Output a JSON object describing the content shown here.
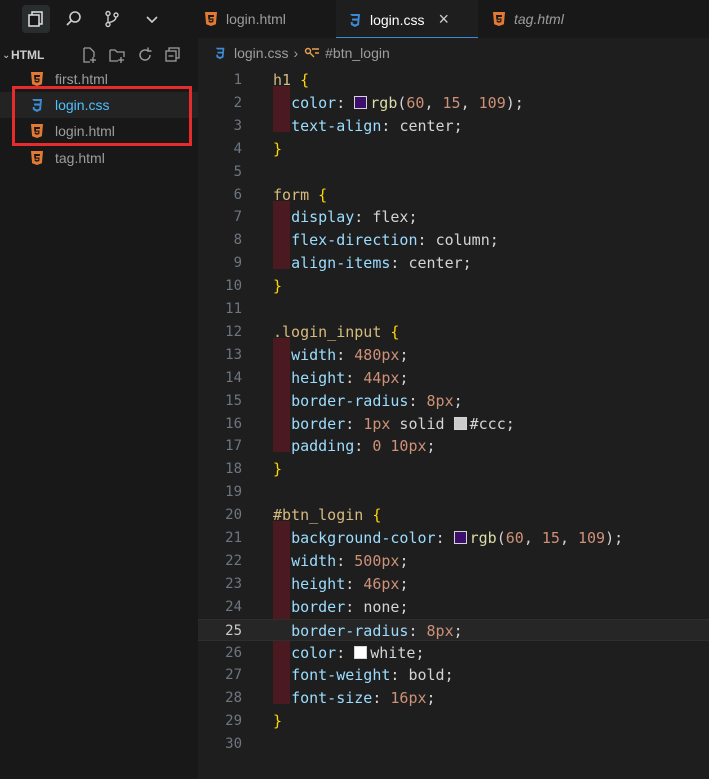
{
  "tabs": [
    {
      "label": "login.html",
      "active": false,
      "italic": false
    },
    {
      "label": "login.css",
      "active": true,
      "italic": false,
      "close": "×"
    },
    {
      "label": "tag.html",
      "active": false,
      "italic": true
    }
  ],
  "sidebar": {
    "title": "HTML",
    "files": [
      {
        "name": "first.html",
        "type": "html"
      },
      {
        "name": "login.css",
        "type": "css",
        "selected": true
      },
      {
        "name": "login.html",
        "type": "html"
      },
      {
        "name": "tag.html",
        "type": "html"
      }
    ]
  },
  "breadcrumb": {
    "file": "login.css",
    "symbol": "#btn_login"
  },
  "colors": {
    "html_icon": "#e37933",
    "css_icon": "#3c8bd7",
    "swatch_purple": "#3c0f6d",
    "swatch_ccc": "#cccccc",
    "swatch_white": "#ffffff",
    "annotation_box": "#e52b2b"
  },
  "code_lines": [
    {
      "n": "1",
      "tokens": [
        [
          "sel",
          "h1 "
        ],
        [
          "br",
          "{"
        ]
      ]
    },
    {
      "n": "2",
      "tokens": [
        [
          "ws",
          "  "
        ],
        [
          "prop",
          "color"
        ],
        [
          "plain",
          ": "
        ],
        [
          "swatch",
          "#3c0f6d"
        ],
        [
          "fn",
          "rgb"
        ],
        [
          "plain",
          "("
        ],
        [
          "num",
          "60"
        ],
        [
          "plain",
          ", "
        ],
        [
          "num",
          "15"
        ],
        [
          "plain",
          ", "
        ],
        [
          "num",
          "109"
        ],
        [
          "plain",
          ");"
        ]
      ]
    },
    {
      "n": "3",
      "tokens": [
        [
          "ws",
          "  "
        ],
        [
          "prop",
          "text-align"
        ],
        [
          "plain",
          ": "
        ],
        [
          "plain",
          "center"
        ],
        [
          "plain",
          ";"
        ]
      ]
    },
    {
      "n": "4",
      "tokens": [
        [
          "br",
          "}"
        ]
      ]
    },
    {
      "n": "5",
      "tokens": []
    },
    {
      "n": "6",
      "tokens": [
        [
          "sel",
          "form "
        ],
        [
          "br",
          "{"
        ]
      ]
    },
    {
      "n": "7",
      "tokens": [
        [
          "ws",
          "  "
        ],
        [
          "prop",
          "display"
        ],
        [
          "plain",
          ": "
        ],
        [
          "plain",
          "flex"
        ],
        [
          "plain",
          ";"
        ]
      ]
    },
    {
      "n": "8",
      "tokens": [
        [
          "ws",
          "  "
        ],
        [
          "prop",
          "flex-direction"
        ],
        [
          "plain",
          ": "
        ],
        [
          "plain",
          "column"
        ],
        [
          "plain",
          ";"
        ]
      ]
    },
    {
      "n": "9",
      "tokens": [
        [
          "ws",
          "  "
        ],
        [
          "prop",
          "align-items"
        ],
        [
          "plain",
          ": "
        ],
        [
          "plain",
          "center"
        ],
        [
          "plain",
          ";"
        ]
      ]
    },
    {
      "n": "10",
      "tokens": [
        [
          "br",
          "}"
        ]
      ]
    },
    {
      "n": "11",
      "tokens": []
    },
    {
      "n": "12",
      "tokens": [
        [
          "sel",
          ".login_input "
        ],
        [
          "br",
          "{"
        ]
      ]
    },
    {
      "n": "13",
      "tokens": [
        [
          "ws",
          "  "
        ],
        [
          "prop",
          "width"
        ],
        [
          "plain",
          ": "
        ],
        [
          "num",
          "480px"
        ],
        [
          "plain",
          ";"
        ]
      ]
    },
    {
      "n": "14",
      "tokens": [
        [
          "ws",
          "  "
        ],
        [
          "prop",
          "height"
        ],
        [
          "plain",
          ": "
        ],
        [
          "num",
          "44px"
        ],
        [
          "plain",
          ";"
        ]
      ]
    },
    {
      "n": "15",
      "tokens": [
        [
          "ws",
          "  "
        ],
        [
          "prop",
          "border-radius"
        ],
        [
          "plain",
          ": "
        ],
        [
          "num",
          "8px"
        ],
        [
          "plain",
          ";"
        ]
      ]
    },
    {
      "n": "16",
      "tokens": [
        [
          "ws",
          "  "
        ],
        [
          "prop",
          "border"
        ],
        [
          "plain",
          ": "
        ],
        [
          "num",
          "1px"
        ],
        [
          "plain",
          " solid "
        ],
        [
          "swatch",
          "#cccccc"
        ],
        [
          "fn2",
          "#ccc"
        ],
        [
          "plain",
          ";"
        ]
      ]
    },
    {
      "n": "17",
      "tokens": [
        [
          "ws",
          "  "
        ],
        [
          "prop",
          "padding"
        ],
        [
          "plain",
          ": "
        ],
        [
          "num",
          "0"
        ],
        [
          "plain",
          " "
        ],
        [
          "num",
          "10px"
        ],
        [
          "plain",
          ";"
        ]
      ]
    },
    {
      "n": "18",
      "tokens": [
        [
          "br",
          "}"
        ]
      ]
    },
    {
      "n": "19",
      "tokens": []
    },
    {
      "n": "20",
      "tokens": [
        [
          "sel2",
          "#btn_login "
        ],
        [
          "br",
          "{"
        ]
      ]
    },
    {
      "n": "21",
      "tokens": [
        [
          "ws",
          "  "
        ],
        [
          "prop",
          "background-color"
        ],
        [
          "plain",
          ": "
        ],
        [
          "swatch",
          "#3c0f6d"
        ],
        [
          "fn",
          "rgb"
        ],
        [
          "plain",
          "("
        ],
        [
          "num",
          "60"
        ],
        [
          "plain",
          ", "
        ],
        [
          "num",
          "15"
        ],
        [
          "plain",
          ", "
        ],
        [
          "num",
          "109"
        ],
        [
          "plain",
          ");"
        ]
      ]
    },
    {
      "n": "22",
      "tokens": [
        [
          "ws",
          "  "
        ],
        [
          "prop",
          "width"
        ],
        [
          "plain",
          ": "
        ],
        [
          "num",
          "500px"
        ],
        [
          "plain",
          ";"
        ]
      ]
    },
    {
      "n": "23",
      "tokens": [
        [
          "ws",
          "  "
        ],
        [
          "prop",
          "height"
        ],
        [
          "plain",
          ": "
        ],
        [
          "num",
          "46px"
        ],
        [
          "plain",
          ";"
        ]
      ]
    },
    {
      "n": "24",
      "tokens": [
        [
          "ws",
          "  "
        ],
        [
          "prop",
          "border"
        ],
        [
          "plain",
          ": "
        ],
        [
          "plain",
          "none"
        ],
        [
          "plain",
          ";"
        ]
      ]
    },
    {
      "n": "25",
      "tokens": [
        [
          "ws",
          "  "
        ],
        [
          "prop",
          "border-radius"
        ],
        [
          "plain",
          ": "
        ],
        [
          "num",
          "8px"
        ],
        [
          "plain",
          ";"
        ]
      ],
      "current": true
    },
    {
      "n": "26",
      "tokens": [
        [
          "ws",
          "  "
        ],
        [
          "prop",
          "color"
        ],
        [
          "plain",
          ": "
        ],
        [
          "swatch",
          "#ffffff"
        ],
        [
          "plain",
          "white"
        ],
        [
          "plain",
          ";"
        ]
      ]
    },
    {
      "n": "27",
      "tokens": [
        [
          "ws",
          "  "
        ],
        [
          "prop",
          "font-weight"
        ],
        [
          "plain",
          ": "
        ],
        [
          "plain",
          "bold"
        ],
        [
          "plain",
          ";"
        ]
      ]
    },
    {
      "n": "28",
      "tokens": [
        [
          "ws",
          "  "
        ],
        [
          "prop",
          "font-size"
        ],
        [
          "plain",
          ": "
        ],
        [
          "num",
          "16px"
        ],
        [
          "plain",
          ";"
        ]
      ]
    },
    {
      "n": "29",
      "tokens": [
        [
          "br",
          "}"
        ]
      ]
    },
    {
      "n": "30",
      "tokens": []
    }
  ]
}
